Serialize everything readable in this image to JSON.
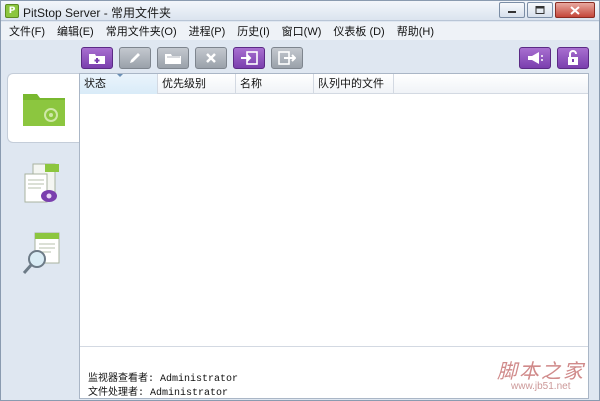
{
  "window": {
    "title": "PitStop Server  -  常用文件夹",
    "app_icon_letter": "P"
  },
  "menu": [
    {
      "label": "文件(F)"
    },
    {
      "label": "编辑(E)"
    },
    {
      "label": "常用文件夹(O)"
    },
    {
      "label": "进程(P)"
    },
    {
      "label": "历史(I)"
    },
    {
      "label": "窗口(W)"
    },
    {
      "label": "仪表板 (D)"
    },
    {
      "label": "帮助(H)"
    }
  ],
  "toolbar": {
    "buttons": [
      {
        "icon": "new-folder-icon",
        "color": "#7a3fae"
      },
      {
        "icon": "pencil-icon",
        "color": "#9aa1aa"
      },
      {
        "icon": "folder-icon",
        "color": "#9aa1aa"
      },
      {
        "icon": "delete-x-icon",
        "color": "#9aa1aa"
      },
      {
        "icon": "import-icon",
        "color": "#7a3fae"
      },
      {
        "icon": "export-icon",
        "color": "#9aa1aa"
      }
    ],
    "right_buttons": [
      {
        "icon": "megaphone-icon"
      },
      {
        "icon": "unlock-icon"
      }
    ]
  },
  "sidebar": [
    {
      "icon": "hot-folder-icon",
      "active": true
    },
    {
      "icon": "pdf-processing-icon",
      "active": false
    },
    {
      "icon": "report-search-icon",
      "active": false
    }
  ],
  "table": {
    "columns": [
      {
        "label": "状态"
      },
      {
        "label": "优先级别"
      },
      {
        "label": "名称"
      },
      {
        "label": "队列中的文件"
      }
    ]
  },
  "status": {
    "monitor_viewer": "监视器查看者: Administrator",
    "file_processor": "文件处理者: Administrator"
  },
  "watermark": {
    "cn": "脚本之家",
    "url": "www.jb51.net"
  },
  "colors": {
    "accent_purple": "#7a3fae",
    "folder_green": "#8cc63f"
  }
}
